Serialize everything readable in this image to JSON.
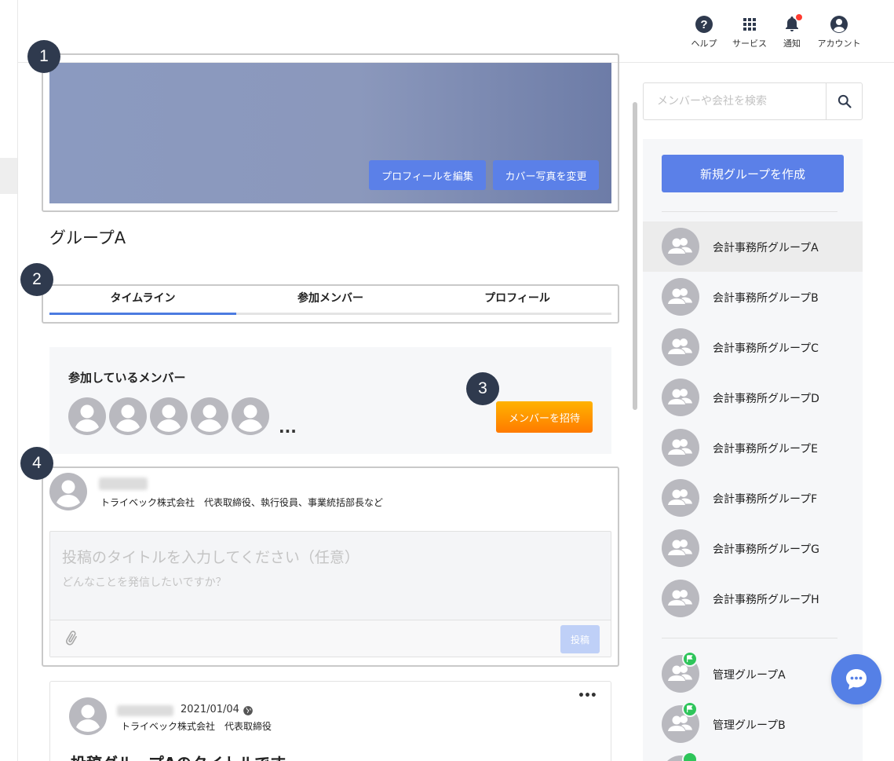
{
  "header": {
    "nav": [
      {
        "label": "ヘルプ",
        "icon": "help-icon"
      },
      {
        "label": "サービス",
        "icon": "grid-icon"
      },
      {
        "label": "通知",
        "icon": "bell-icon"
      },
      {
        "label": "アカウント",
        "icon": "account-icon"
      }
    ]
  },
  "markers": [
    "1",
    "2",
    "3",
    "4"
  ],
  "cover": {
    "edit_profile": "プロフィールを編集",
    "change_cover": "カバー写真を変更"
  },
  "group": {
    "name": "グループA"
  },
  "tabs": [
    {
      "label": "タイムライン",
      "active": true
    },
    {
      "label": "参加メンバー",
      "active": false
    },
    {
      "label": "プロフィール",
      "active": false
    }
  ],
  "members": {
    "title": "参加しているメンバー",
    "more": "...",
    "invite": "メンバーを招待"
  },
  "composer": {
    "user_org": "トライベック株式会社　代表取締役、執行役員、事業統括部長など",
    "title_placeholder": "投稿のタイトルを入力してください（任意）",
    "body_placeholder": "どんなことを発信したいですか？",
    "post_label": "投稿"
  },
  "post": {
    "date": "2021/01/04",
    "user_org": "トライベック株式会社　代表取締役",
    "more": "•••",
    "title": "投稿グループAのタイトルです"
  },
  "sidebar": {
    "search_placeholder": "メンバーや会社を検索",
    "create_group": "新規グループを作成",
    "groups": [
      {
        "name": "会計事務所グループA",
        "active": true
      },
      {
        "name": "会計事務所グループB"
      },
      {
        "name": "会計事務所グループC"
      },
      {
        "name": "会計事務所グループD"
      },
      {
        "name": "会計事務所グループE"
      },
      {
        "name": "会計事務所グループF"
      },
      {
        "name": "会計事務所グループG"
      },
      {
        "name": "会計事務所グループH"
      }
    ],
    "admin_groups": [
      {
        "name": "管理グループA"
      },
      {
        "name": "管理グループB"
      }
    ]
  },
  "colors": {
    "primary": "#5b80e8",
    "accent_orange": "#ff8a00",
    "marker": "#2f3a4e",
    "flag": "#2ec55a",
    "notification_dot": "#ff3b30"
  }
}
